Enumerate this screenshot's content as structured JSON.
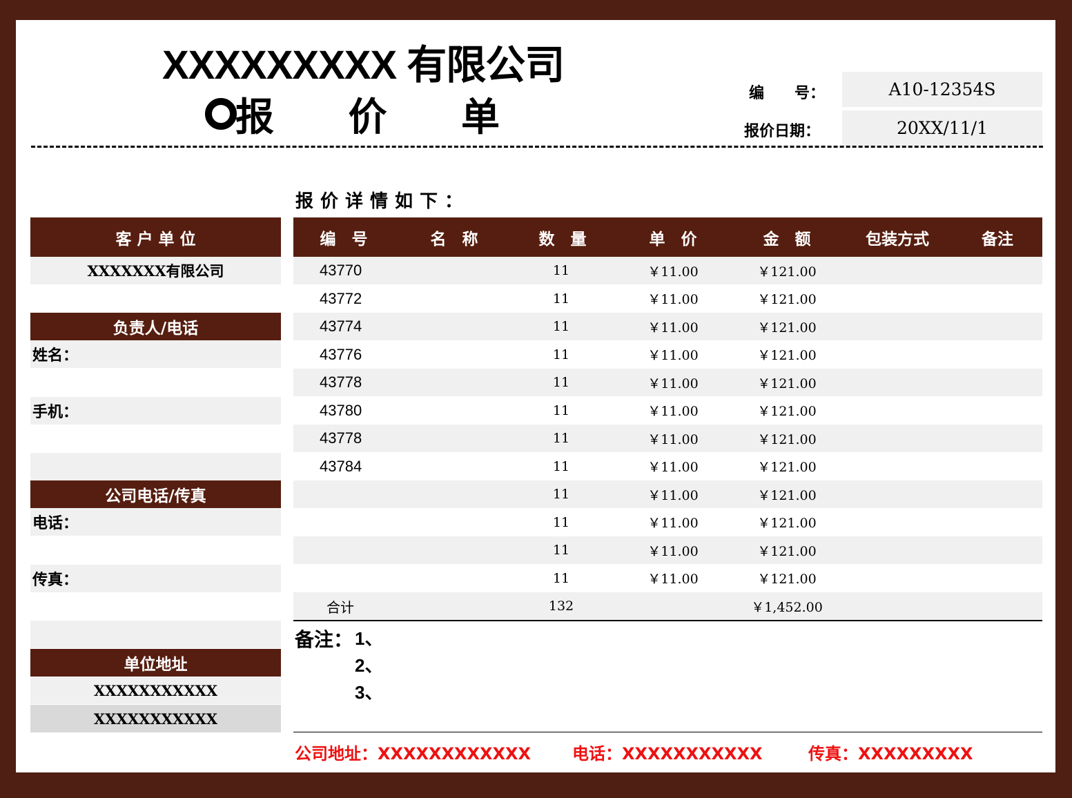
{
  "header": {
    "company_title": "XXXXXXXXX 有限公司",
    "doc_title": "报 价 单",
    "number_label": "编　　号：",
    "number_value": "A10-12354S",
    "date_label": "报价日期：",
    "date_value": "20XX/11/1"
  },
  "intro": "报价详情如下：",
  "left_panel": {
    "customer_heading": "客 户 单 位",
    "customer_value": "XXXXXXX有限公司",
    "contact_heading": "负责人/电话",
    "name_label": "姓名：",
    "mobile_label": "手机：",
    "company_phone_heading": "公司电话/传真",
    "phone_label": "电话：",
    "fax_label": "传真：",
    "address_heading": "单位地址",
    "address_line1": "XXXXXXXXXXX",
    "address_line2": "XXXXXXXXXXX"
  },
  "table": {
    "headers": [
      "编　号",
      "名　称",
      "数　量",
      "单　价",
      "金　额",
      "包装方式",
      "备注"
    ],
    "rows": [
      {
        "code": "43770",
        "qty": "11",
        "price": "￥11.00",
        "amount": "￥121.00"
      },
      {
        "code": "43772",
        "qty": "11",
        "price": "￥11.00",
        "amount": "￥121.00"
      },
      {
        "code": "43774",
        "qty": "11",
        "price": "￥11.00",
        "amount": "￥121.00"
      },
      {
        "code": "43776",
        "qty": "11",
        "price": "￥11.00",
        "amount": "￥121.00"
      },
      {
        "code": "43778",
        "qty": "11",
        "price": "￥11.00",
        "amount": "￥121.00"
      },
      {
        "code": "43780",
        "qty": "11",
        "price": "￥11.00",
        "amount": "￥121.00"
      },
      {
        "code": "43778",
        "qty": "11",
        "price": "￥11.00",
        "amount": "￥121.00"
      },
      {
        "code": "43784",
        "qty": "11",
        "price": "￥11.00",
        "amount": "￥121.00"
      },
      {
        "code": "",
        "qty": "11",
        "price": "￥11.00",
        "amount": "￥121.00"
      },
      {
        "code": "",
        "qty": "11",
        "price": "￥11.00",
        "amount": "￥121.00"
      },
      {
        "code": "",
        "qty": "11",
        "price": "￥11.00",
        "amount": "￥121.00"
      },
      {
        "code": "",
        "qty": "11",
        "price": "￥11.00",
        "amount": "￥121.00"
      }
    ],
    "total": {
      "label": "合计",
      "qty": "132",
      "amount": "￥1,452.00"
    }
  },
  "notes": {
    "label": "备注：",
    "items": [
      "1、",
      "2、",
      "3、"
    ]
  },
  "footer": {
    "address": "公司地址：XXXXXXXXXXXX",
    "phone": "电话：XXXXXXXXXXX",
    "fax": "传真：XXXXXXXXX"
  },
  "colors": {
    "frame": "#4e1f12",
    "header_bg": "#561e10",
    "row_alt": "#f0f0f0",
    "footer_text": "#ee1111"
  }
}
